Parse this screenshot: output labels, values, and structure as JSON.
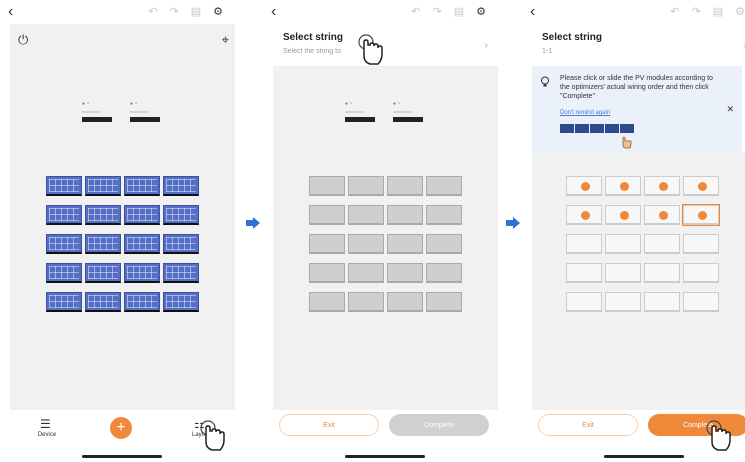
{
  "panel1": {
    "nav": {
      "device_label": "Device",
      "layout_label": "Layout"
    }
  },
  "panel2": {
    "title": "Select string",
    "subtitle": "Select the string to",
    "exit_label": "Exit",
    "complete_label": "Complete"
  },
  "panel3": {
    "title": "Select string",
    "subtitle": "1-1",
    "tip_text": "Please click or slide the PV modules according to the optimizers' actual wiring order and then click \"Complete\"",
    "dont_remind": "Don't remind again",
    "exit_label": "Exit",
    "complete_label": "Complete"
  },
  "colors": {
    "accent": "#f0883a",
    "module_blue": "#5470c6",
    "arrow_blue": "#2f6fd6"
  }
}
